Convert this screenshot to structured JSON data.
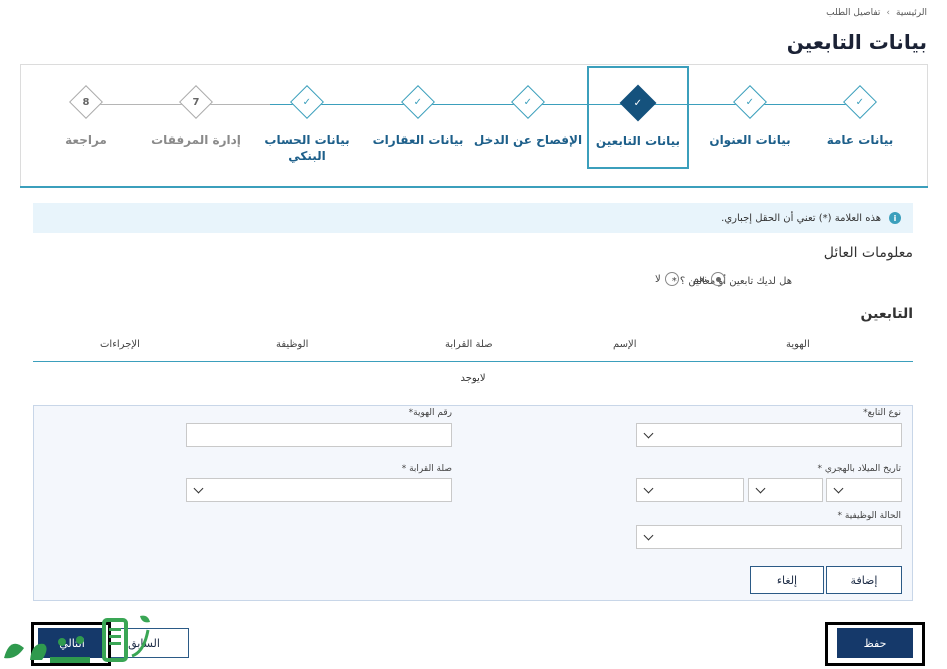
{
  "breadcrumb": {
    "home": "الرئيسية",
    "separator": "›",
    "current": "تفاصيل الطلب"
  },
  "page_title": "بيانات التابعين",
  "steps": [
    {
      "label": "بيانات عامة",
      "state": "done",
      "icon": "check-icon"
    },
    {
      "label": "بيانات العنوان",
      "state": "done",
      "icon": "check-icon"
    },
    {
      "label": "بيانات التابعين",
      "state": "active",
      "icon": "check-icon"
    },
    {
      "label": "الإفصاح عن الدخل",
      "state": "done",
      "icon": "check-icon"
    },
    {
      "label": "بيانات العقارات",
      "state": "done",
      "icon": "check-icon"
    },
    {
      "label": "بيانات الحساب البنكي",
      "state": "done",
      "icon": "check-icon"
    },
    {
      "label": "إدارة المرفقات",
      "state": "future",
      "number": "7"
    },
    {
      "label": "مراجعة",
      "state": "future",
      "number": "8"
    }
  ],
  "info": {
    "text": "هذه العلامة (*) تعني أن الحقل إجباري.",
    "icon": "info-icon"
  },
  "family_section": {
    "title": "معلومات العائل",
    "question": "هل لديك تابعين أو معالين ؟ *",
    "options": [
      {
        "label": "نعم",
        "selected": true
      },
      {
        "label": "لا",
        "selected": false
      }
    ]
  },
  "dependents": {
    "title": "التابعين",
    "columns": [
      "الهوية",
      "الإسم",
      "صلة القرابة",
      "الوظيفة",
      "الإجراءات"
    ],
    "empty_text": "لايوجد"
  },
  "form": {
    "dependent_type_label": "نوع التابع*",
    "id_number_label": "رقم الهوية*",
    "dob_label": "تاريخ الميلاد بالهجري *",
    "relation_label": "صلة القرابة *",
    "job_status_label": "الحالة الوظيفية *",
    "add_button": "إضافة",
    "cancel_button": "إلغاء"
  },
  "nav": {
    "save": "حفظ",
    "previous": "السابق",
    "next": "التالي"
  },
  "colors": {
    "accent": "#3b9fbc",
    "primary": "#15396a",
    "info_bg": "#e8f4fb"
  }
}
